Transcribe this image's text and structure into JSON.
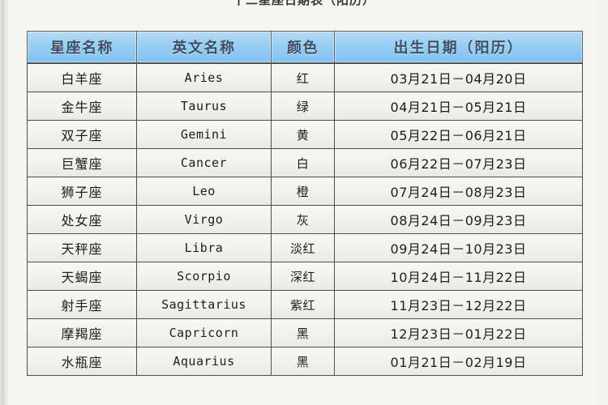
{
  "page": {
    "title": "十二星座日期表（阳历）"
  },
  "table": {
    "headers": [
      "星座名称",
      "英文名称",
      "颜色",
      "出生日期（阳历）"
    ],
    "rows": [
      {
        "name": "白羊座",
        "english": "Aries",
        "color": "红",
        "date": "03月21日－04月20日"
      },
      {
        "name": "金牛座",
        "english": "Taurus",
        "color": "绿",
        "date": "04月21日－05月21日"
      },
      {
        "name": "双子座",
        "english": "Gemini",
        "color": "黄",
        "date": "05月22日－06月21日"
      },
      {
        "name": "巨蟹座",
        "english": "Cancer",
        "color": "白",
        "date": "06月22日－07月23日"
      },
      {
        "name": "狮子座",
        "english": "Leo",
        "color": "橙",
        "date": "07月24日－08月23日"
      },
      {
        "name": "处女座",
        "english": "Virgo",
        "color": "灰",
        "date": "08月24日－09月23日"
      },
      {
        "name": "天秤座",
        "english": "Libra",
        "color": "淡红",
        "date": "09月24日－10月23日"
      },
      {
        "name": "天蝎座",
        "english": "Scorpio",
        "color": "深红",
        "date": "10月24日－11月22日"
      },
      {
        "name": "射手座",
        "english": "Sagittarius",
        "color": "紫红",
        "date": "11月23日－12月22日"
      },
      {
        "name": "摩羯座",
        "english": "Capricorn",
        "color": "黑",
        "date": "12月23日－01月22日"
      },
      {
        "name": "水瓶座",
        "english": "Aquarius",
        "color": "黑",
        "date": "01月21日－02月19日"
      }
    ]
  },
  "colors": {
    "header_fill_top": "#b6dbf5",
    "header_fill_bottom": "#7fc2f0",
    "header_text": "#3e4f63",
    "cell_fill": "#f2f2ee",
    "border": "#4a4a4a",
    "page_background": "#f5f5f1"
  }
}
